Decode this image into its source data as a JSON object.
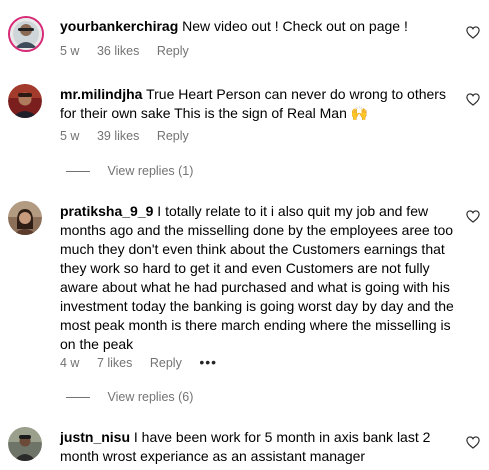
{
  "comments": [
    {
      "username": "yourbankerchirag",
      "text": "New video out ! Check out on page !",
      "time": "5 w",
      "likes": "36 likes",
      "reply": "Reply"
    },
    {
      "username": "mr.milindjha",
      "text": "True Heart Person can never do wrong to others for their own sake This is the sign of Real Man 🙌",
      "time": "5 w",
      "likes": "39 likes",
      "reply": "Reply",
      "view_replies": "View replies (1)"
    },
    {
      "username": "pratiksha_9_9",
      "text": "I totally relate to it i also quit my job and few months ago and the misselling done by the employees aree too much they don't even think about the Customers earnings that they work so hard to get it and even Customers are not fully aware about what he had purchased and what is going with his investment today the banking is going worst day by day and the most peak month is there march ending where the misselling is on the peak",
      "time": "4 w",
      "likes": "7 likes",
      "reply": "Reply",
      "more": "•••",
      "view_replies": "View replies (6)"
    },
    {
      "username": "justn_nisu",
      "text": "I have been work for 5 month in axis bank last 2 month wrost experiance as an assistant manager"
    }
  ]
}
